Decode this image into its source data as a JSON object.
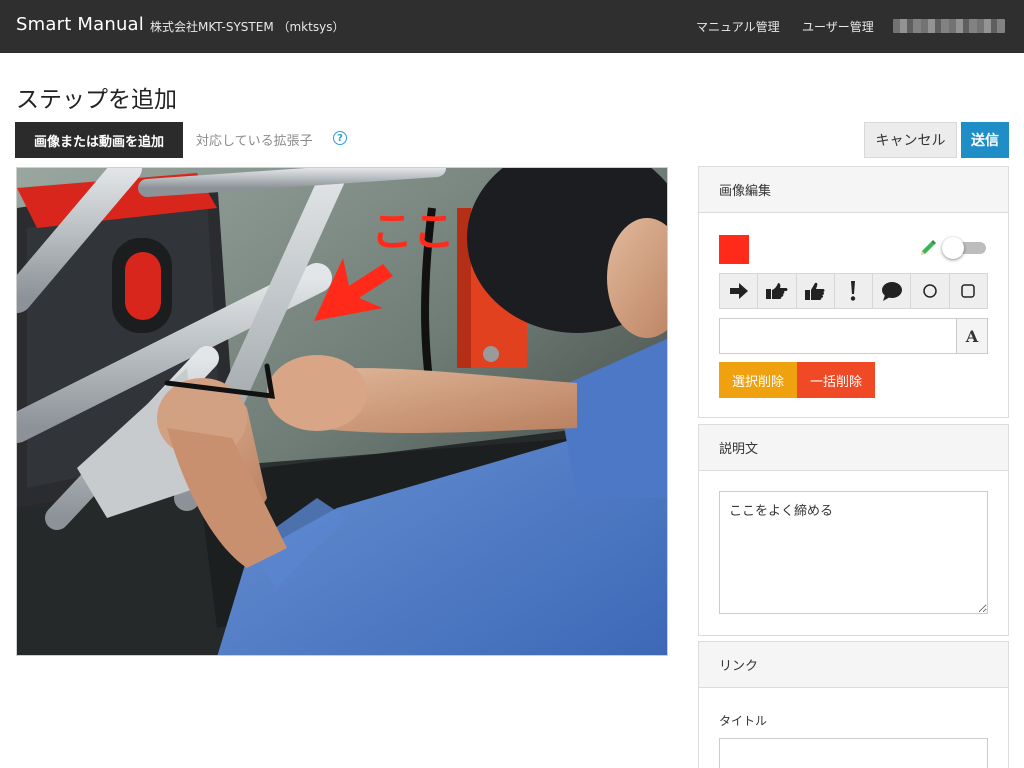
{
  "header": {
    "brand": "Smart Manual",
    "company": "株式会社MKT-SYSTEM （mktsys）",
    "nav_manual": "マニュアル管理",
    "nav_users": "ユーザー管理"
  },
  "page": {
    "title": "ステップを追加",
    "add_media_label": "画像または動画を追加",
    "extensions_label": "対応している拡張子",
    "cancel_label": "キャンセル",
    "send_label": "送信"
  },
  "photo": {
    "annotation_text": "ここ",
    "annotation_color": "#ff2a1a"
  },
  "image_edit": {
    "title": "画像編集",
    "selected_color": "#ff2a1a",
    "toggle_on": false,
    "tools": [
      "arrow-icon",
      "pointing-hand-icon",
      "thumbs-up-icon",
      "exclamation-icon",
      "speech-bubble-icon",
      "circle-icon",
      "rounded-square-icon"
    ],
    "text_input_value": "",
    "text_button": "A",
    "delete_selected_label": "選択削除",
    "delete_all_label": "一括削除"
  },
  "description": {
    "title": "説明文",
    "value": "ここをよく締める"
  },
  "link": {
    "title": "リンク",
    "title_label": "タイトル",
    "title_value": ""
  },
  "colors": {
    "navbar": "#2f2f2f",
    "primary": "#1f8ec7",
    "warning": "#f0a10f",
    "danger": "#ef4a25"
  }
}
